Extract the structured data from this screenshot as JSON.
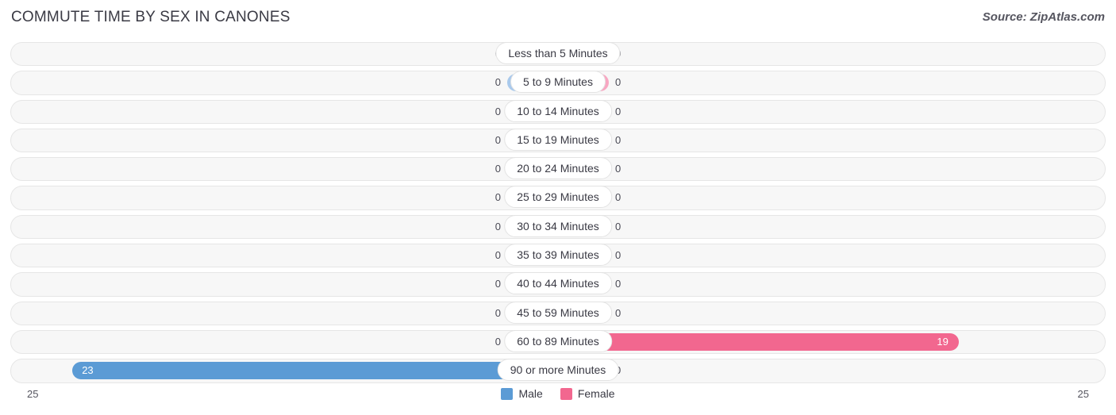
{
  "header": {
    "title": "COMMUTE TIME BY SEX IN CANONES",
    "source": "Source: ZipAtlas.com"
  },
  "axis": {
    "left_label": "25",
    "right_label": "25",
    "max": 25
  },
  "legend": {
    "male_label": "Male",
    "female_label": "Female",
    "male_color": "#5b9bd5",
    "female_color": "#f2678f",
    "male_color_muted": "#a9c9ec",
    "female_color_muted": "#f8a7c2"
  },
  "chart_data": {
    "type": "bar",
    "title": "COMMUTE TIME BY SEX IN CANONES",
    "subtitle": "Source: ZipAtlas.com",
    "orientation": "horizontal-diverging",
    "xlabel": "",
    "ylabel": "",
    "xlim": [
      25,
      25
    ],
    "grid": false,
    "legend_position": "bottom-center",
    "categories": [
      "Less than 5 Minutes",
      "5 to 9 Minutes",
      "10 to 14 Minutes",
      "15 to 19 Minutes",
      "20 to 24 Minutes",
      "25 to 29 Minutes",
      "30 to 34 Minutes",
      "35 to 39 Minutes",
      "40 to 44 Minutes",
      "45 to 59 Minutes",
      "60 to 89 Minutes",
      "90 or more Minutes"
    ],
    "series": [
      {
        "name": "Male",
        "side": "left",
        "values": [
          0,
          0,
          0,
          0,
          0,
          0,
          0,
          0,
          0,
          0,
          0,
          23
        ]
      },
      {
        "name": "Female",
        "side": "right",
        "values": [
          0,
          0,
          0,
          0,
          0,
          0,
          0,
          0,
          0,
          0,
          19,
          0
        ]
      }
    ]
  },
  "rows": [
    {
      "label": "Less than 5 Minutes",
      "male": "0",
      "female": "0"
    },
    {
      "label": "5 to 9 Minutes",
      "male": "0",
      "female": "0"
    },
    {
      "label": "10 to 14 Minutes",
      "male": "0",
      "female": "0"
    },
    {
      "label": "15 to 19 Minutes",
      "male": "0",
      "female": "0"
    },
    {
      "label": "20 to 24 Minutes",
      "male": "0",
      "female": "0"
    },
    {
      "label": "25 to 29 Minutes",
      "male": "0",
      "female": "0"
    },
    {
      "label": "30 to 34 Minutes",
      "male": "0",
      "female": "0"
    },
    {
      "label": "35 to 39 Minutes",
      "male": "0",
      "female": "0"
    },
    {
      "label": "40 to 44 Minutes",
      "male": "0",
      "female": "0"
    },
    {
      "label": "45 to 59 Minutes",
      "male": "0",
      "female": "0"
    },
    {
      "label": "60 to 89 Minutes",
      "male": "0",
      "female": "19"
    },
    {
      "label": "90 or more Minutes",
      "male": "23",
      "female": "0"
    }
  ]
}
